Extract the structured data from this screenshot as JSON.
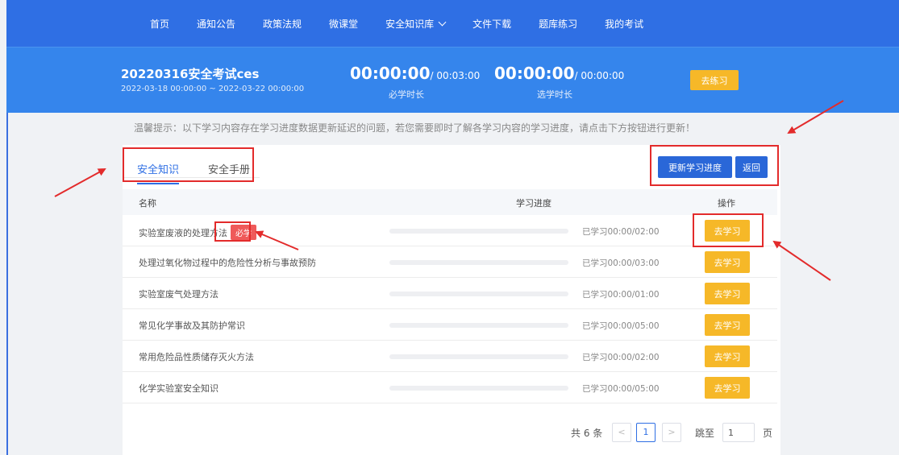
{
  "nav": {
    "items": [
      "首页",
      "通知公告",
      "政策法规",
      "微课堂",
      "安全知识库",
      "文件下载",
      "题库练习",
      "我的考试"
    ]
  },
  "exam": {
    "title": "20220316安全考试ces",
    "range": "2022-03-18 00:00:00 ~ 2022-03-22 00:00:00",
    "required": {
      "studied": "00:00:00",
      "total": "/ 00:03:00",
      "label": "必学时长"
    },
    "elective": {
      "studied": "00:00:00",
      "total": "/ 00:00:00",
      "label": "选学时长"
    },
    "practice_label": "去练习"
  },
  "tip": "温馨提示：以下学习内容存在学习进度数据更新延迟的问题，若您需要即时了解各学习内容的学习进度，请点击下方按钮进行更新！",
  "tabs": [
    {
      "label": "安全知识",
      "active": true
    },
    {
      "label": "安全手册",
      "active": false
    }
  ],
  "actions": {
    "update_label": "更新学习进度",
    "back_label": "返回"
  },
  "table": {
    "headers": {
      "name": "名称",
      "progress": "学习进度",
      "ops": "操作"
    },
    "rows": [
      {
        "name": "实验室废液的处理方法",
        "badge": "必学",
        "progress": 0,
        "status": "已学习00:00/02:00",
        "action": "去学习"
      },
      {
        "name": "处理过氧化物过程中的危险性分析与事故预防",
        "badge": "",
        "progress": 0,
        "status": "已学习00:00/03:00",
        "action": "去学习"
      },
      {
        "name": "实验室废气处理方法",
        "badge": "",
        "progress": 0,
        "status": "已学习00:00/01:00",
        "action": "去学习"
      },
      {
        "name": "常见化学事故及其防护常识",
        "badge": "",
        "progress": 0,
        "status": "已学习00:00/05:00",
        "action": "去学习"
      },
      {
        "name": "常用危险品性质储存灭火方法",
        "badge": "",
        "progress": 0,
        "status": "已学习00:00/02:00",
        "action": "去学习"
      },
      {
        "name": "化学实验室安全知识",
        "badge": "",
        "progress": 0,
        "status": "已学习00:00/05:00",
        "action": "去学习"
      }
    ]
  },
  "pager": {
    "total": "共 6 条",
    "prev": "<",
    "current": "1",
    "next": ">",
    "goto": "跳至",
    "jump_value": "1",
    "unit": "页"
  },
  "colors": {
    "nav_bg": "#2f6fe4",
    "banner_bg": "#3585ec",
    "accent_yellow": "#f6b828",
    "badge_red": "#ef5a5a",
    "annotation_red": "#e32b2b"
  }
}
